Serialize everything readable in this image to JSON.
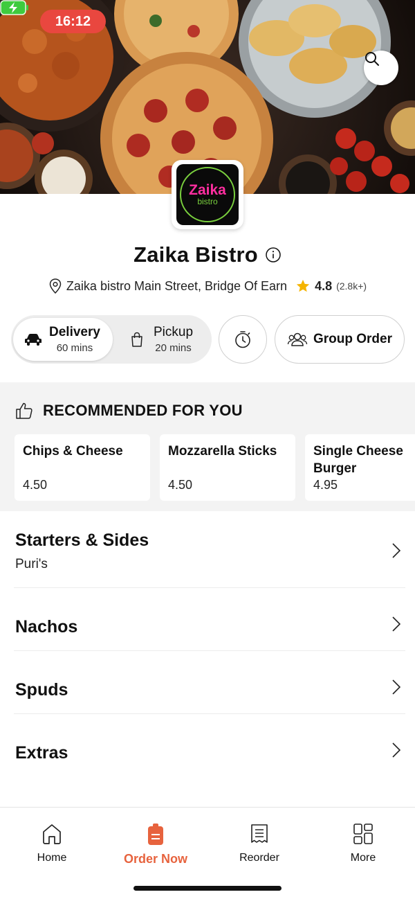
{
  "status_bar": {
    "time": "16:12"
  },
  "restaurant": {
    "logo_text": "Zaika",
    "logo_subtext": "bistro",
    "name": "Zaika Bistro",
    "address": "Zaika bistro Main Street, Bridge Of Earn",
    "rating": "4.8",
    "rating_count": "(2.8k+)"
  },
  "order_modes": {
    "delivery": {
      "label": "Delivery",
      "time": "60 mins",
      "selected": true
    },
    "pickup": {
      "label": "Pickup",
      "time": "20 mins",
      "selected": false
    }
  },
  "group_order_label": "Group Order",
  "recommended": {
    "title": "RECOMMENDED FOR YOU",
    "items": [
      {
        "name": "Chips & Cheese",
        "price": "4.50"
      },
      {
        "name": "Mozzarella Sticks",
        "price": "4.50"
      },
      {
        "name": "Single Cheese Burger",
        "price": "4.95"
      }
    ]
  },
  "categories": [
    {
      "name": "Starters & Sides",
      "subtitle": "Puri's"
    },
    {
      "name": "Nachos"
    },
    {
      "name": "Spuds"
    },
    {
      "name": "Extras"
    }
  ],
  "tabs": [
    {
      "label": "Home",
      "icon": "home-icon"
    },
    {
      "label": "Order Now",
      "icon": "order-now-icon",
      "active": true
    },
    {
      "label": "Reorder",
      "icon": "receipt-icon"
    },
    {
      "label": "More",
      "icon": "grid-icon"
    }
  ],
  "colors": {
    "accent": "#e7633e",
    "time_pill": "#e9473f",
    "rating_star": "#f5b400",
    "logo_pink": "#ff2ea0",
    "logo_green": "#7ad03e"
  }
}
